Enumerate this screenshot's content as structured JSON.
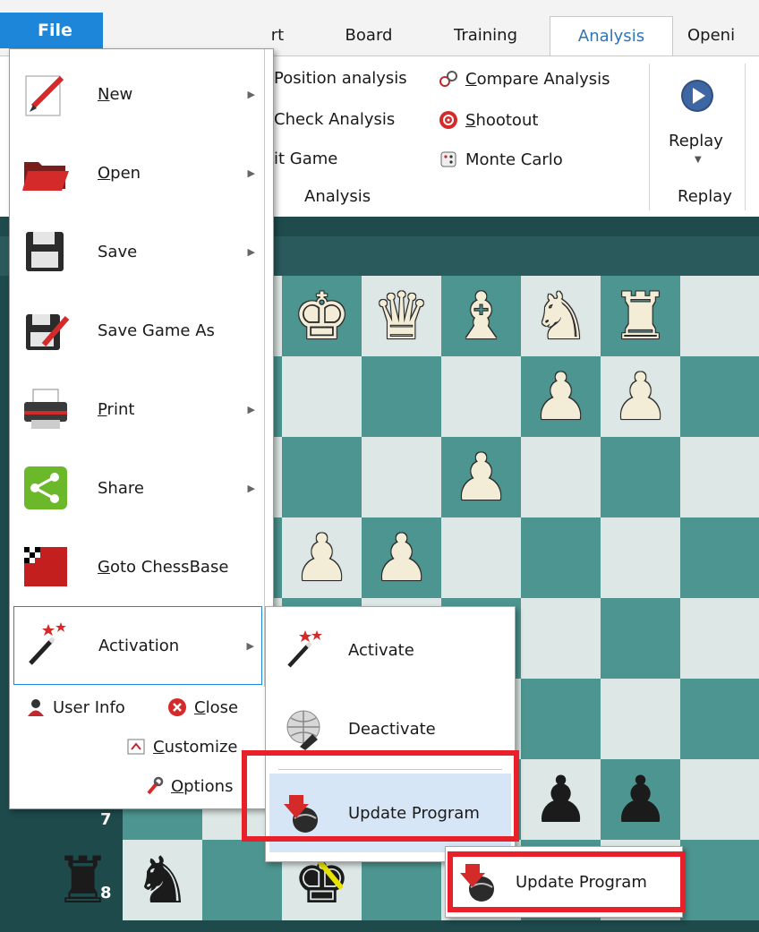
{
  "ribbon": {
    "tabs": [
      {
        "label": "rt"
      },
      {
        "label": "Board"
      },
      {
        "label": "Training"
      },
      {
        "label": "Analysis"
      },
      {
        "label": "Openi"
      }
    ],
    "analysis_group": {
      "items": [
        {
          "label": "Position analysis",
          "icon": "analysis-icon"
        },
        {
          "label": "Check Analysis",
          "icon": "check-icon"
        },
        {
          "label": "it Game",
          "icon": "game-icon"
        },
        {
          "label": "Compare Analysis",
          "icon": "compare-icon"
        },
        {
          "label": "Shootout",
          "icon": "shootout-icon"
        },
        {
          "label": "Monte Carlo",
          "icon": "monte-carlo-icon"
        }
      ],
      "label": "Analysis"
    },
    "replay_group": {
      "button_label": "Replay",
      "label": "Replay"
    }
  },
  "file_menu": {
    "button_label": "File",
    "items": [
      {
        "label": "New",
        "has_submenu": true
      },
      {
        "label": "Open",
        "has_submenu": true
      },
      {
        "label": "Save",
        "has_submenu": true
      },
      {
        "label": "Save Game As",
        "has_submenu": false
      },
      {
        "label": "Print",
        "has_submenu": true
      },
      {
        "label": "Share",
        "has_submenu": true
      },
      {
        "label": "Goto ChessBase",
        "has_submenu": false
      },
      {
        "label": "Activation",
        "has_submenu": true,
        "selected": true
      }
    ],
    "bottom": {
      "user_info": "User Info",
      "close": "Close",
      "customize": "Customize",
      "options": "Options"
    }
  },
  "activation_submenu": {
    "items": [
      {
        "label": "Activate"
      },
      {
        "label": "Deactivate"
      },
      {
        "label": "Update Program",
        "highlighted": true
      }
    ]
  },
  "popup": {
    "label": "Update Program"
  },
  "board": {
    "rank_labels": [
      "7",
      "8"
    ],
    "light_color": "#dde8e6",
    "dark_color": "#4d9590"
  },
  "colors": {
    "accent": "#1d86d8",
    "highlight_box": "#e8202a"
  }
}
